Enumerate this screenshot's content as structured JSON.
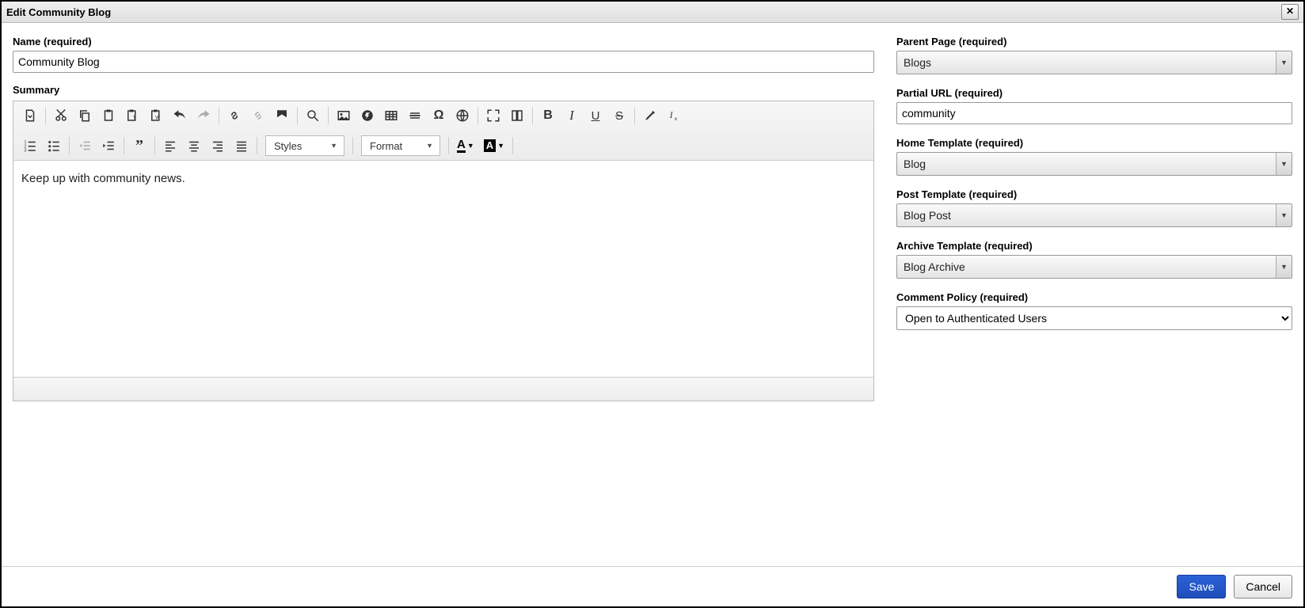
{
  "dialog": {
    "title": "Edit Community Blog"
  },
  "left": {
    "name_label": "Name (required)",
    "name_value": "Community Blog",
    "summary_label": "Summary",
    "summary_body": "Keep up with community news."
  },
  "editor": {
    "styles_label": "Styles",
    "format_label": "Format"
  },
  "right": {
    "parent_page": {
      "label": "Parent Page (required)",
      "value": "Blogs"
    },
    "partial_url": {
      "label": "Partial URL (required)",
      "value": "community"
    },
    "home_template": {
      "label": "Home Template (required)",
      "value": "Blog"
    },
    "post_template": {
      "label": "Post Template (required)",
      "value": "Blog Post"
    },
    "archive_template": {
      "label": "Archive Template (required)",
      "value": "Blog Archive"
    },
    "comment_policy": {
      "label": "Comment Policy (required)",
      "value": "Open to Authenticated Users"
    }
  },
  "footer": {
    "save": "Save",
    "cancel": "Cancel"
  }
}
